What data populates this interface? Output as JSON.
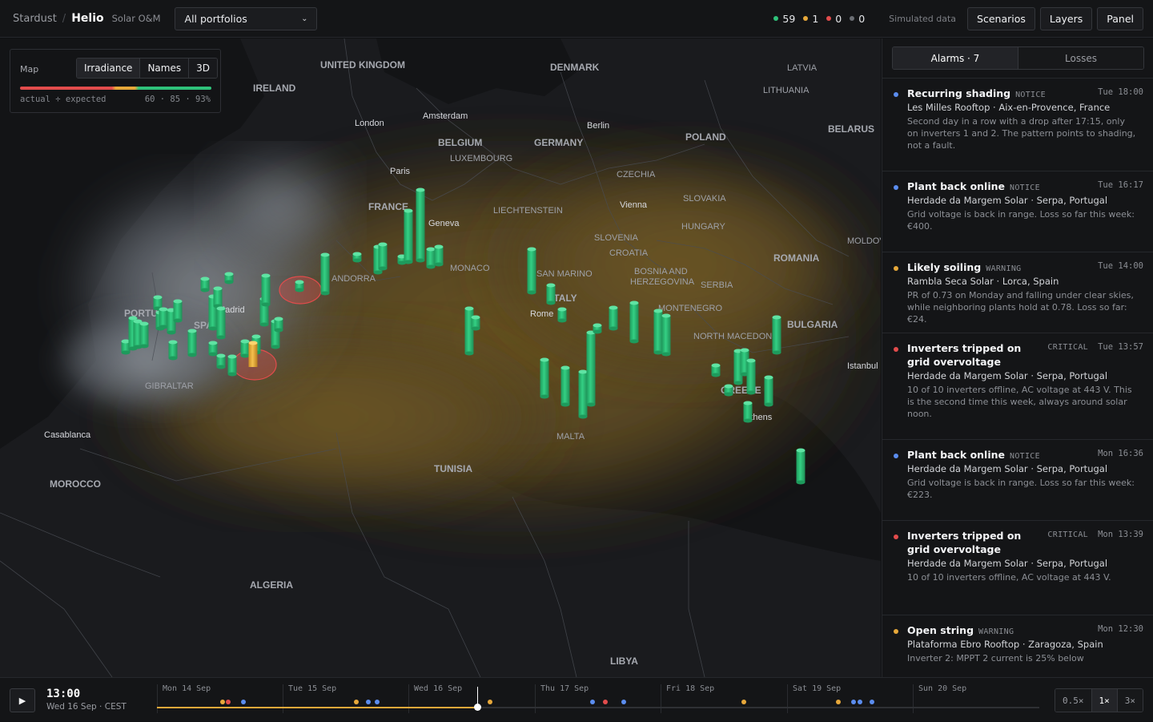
{
  "header": {
    "org": "Stardust",
    "app": "Helio",
    "subtitle": "Solar O&M",
    "portfolio": "All portfolios",
    "counts": [
      {
        "value": "59",
        "color": "#2fc27a"
      },
      {
        "value": "1",
        "color": "#e7a83a"
      },
      {
        "value": "0",
        "color": "#e24c4c"
      },
      {
        "value": "0",
        "color": "#6b6e74"
      }
    ],
    "simulated": "Simulated data",
    "buttons": {
      "scenarios": "Scenarios",
      "layers": "Layers",
      "panel": "Panel"
    }
  },
  "legend": {
    "title": "Map",
    "tabs": [
      "Irradiance",
      "Names",
      "3D"
    ],
    "caption": "actual ÷ expected",
    "scale": "60 · 85 · 93%"
  },
  "map": {
    "labels": [
      {
        "text": "UNITED KINGDOM",
        "kind": "country"
      },
      {
        "text": "IRELAND",
        "kind": "country"
      },
      {
        "text": "DENMARK",
        "kind": "country"
      },
      {
        "text": "LATVIA",
        "kind": "country"
      },
      {
        "text": "LITHUANIA",
        "kind": "country"
      },
      {
        "text": "BELARUS",
        "kind": "country"
      },
      {
        "text": "London",
        "kind": "city"
      },
      {
        "text": "Amsterdam",
        "kind": "city"
      },
      {
        "text": "Berlin",
        "kind": "city"
      },
      {
        "text": "BELGIUM",
        "kind": "country"
      },
      {
        "text": "GERMANY",
        "kind": "country"
      },
      {
        "text": "POLAND",
        "kind": "country"
      },
      {
        "text": "LUXEMBOURG",
        "kind": "minor"
      },
      {
        "text": "Paris",
        "kind": "city"
      },
      {
        "text": "CZECHIA",
        "kind": "minor"
      },
      {
        "text": "FRANCE",
        "kind": "country"
      },
      {
        "text": "Geneva",
        "kind": "city"
      },
      {
        "text": "LIECHTENSTEIN",
        "kind": "minor"
      },
      {
        "text": "Vienna",
        "kind": "city"
      },
      {
        "text": "SLOVAKIA",
        "kind": "minor"
      },
      {
        "text": "HUNGARY",
        "kind": "minor"
      },
      {
        "text": "MOLDOVA",
        "kind": "minor"
      },
      {
        "text": "ROMANIA",
        "kind": "country"
      },
      {
        "text": "SLOVENIA",
        "kind": "minor"
      },
      {
        "text": "CROATIA",
        "kind": "minor"
      },
      {
        "text": "MONACO",
        "kind": "minor"
      },
      {
        "text": "SAN MARINO",
        "kind": "minor"
      },
      {
        "text": "BOSNIA AND",
        "kind": "minor"
      },
      {
        "text": "HERZEGOVINA",
        "kind": "minor"
      },
      {
        "text": "SERBIA",
        "kind": "minor"
      },
      {
        "text": "ANDORRA",
        "kind": "minor"
      },
      {
        "text": "ITALY",
        "kind": "country"
      },
      {
        "text": "Rome",
        "kind": "city"
      },
      {
        "text": "MONTENEGRO",
        "kind": "minor"
      },
      {
        "text": "PORTUGAL",
        "kind": "country"
      },
      {
        "text": "Madrid",
        "kind": "city"
      },
      {
        "text": "SPAIN",
        "kind": "country"
      },
      {
        "text": "NORTH MACEDONIA",
        "kind": "minor"
      },
      {
        "text": "BULGARIA",
        "kind": "country"
      },
      {
        "text": "Istanbul",
        "kind": "city"
      },
      {
        "text": "GREECE",
        "kind": "country"
      },
      {
        "text": "Athens",
        "kind": "city"
      },
      {
        "text": "GIBRALTAR",
        "kind": "minor"
      },
      {
        "text": "Casablanca",
        "kind": "city"
      },
      {
        "text": "MALTA",
        "kind": "minor"
      },
      {
        "text": "TUNISIA",
        "kind": "country"
      },
      {
        "text": "MOROCCO",
        "kind": "country"
      },
      {
        "text": "ALGERIA",
        "kind": "country"
      },
      {
        "text": "LIBYA",
        "kind": "country"
      }
    ]
  },
  "panel": {
    "tabs": [
      "Alarms · 7",
      "Losses"
    ],
    "alarms": [
      {
        "title": "Recurring shading",
        "severity": "NOTICE",
        "color": "#5b8def",
        "time": "Tue 18:00",
        "site": "Les Milles Rooftop · Aix-en-Provence, France",
        "desc": "Second day in a row with a drop after 17:15, only on inverters 1 and 2. The pattern points to shading, not a fault."
      },
      {
        "title": "Plant back online",
        "severity": "NOTICE",
        "color": "#5b8def",
        "time": "Tue 16:17",
        "site": "Herdade da Margem Solar · Serpa, Portugal",
        "desc": "Grid voltage is back in range. Loss so far this week: €400."
      },
      {
        "title": "Likely soiling",
        "severity": "WARNING",
        "color": "#e7a83a",
        "time": "Tue 14:00",
        "site": "Rambla Seca Solar · Lorca, Spain",
        "desc": "PR of 0.73 on Monday and falling under clear skies, while neighboring plants hold at 0.78. Loss so far: €24."
      },
      {
        "title": "Inverters tripped on grid overvoltage",
        "severity": "CRITICAL",
        "color": "#e24c4c",
        "time": "Tue 13:57",
        "site": "Herdade da Margem Solar · Serpa, Portugal",
        "desc": "10 of 10 inverters offline, AC voltage at 443 V. This is the second time this week, always around solar noon."
      },
      {
        "title": "Plant back online",
        "severity": "NOTICE",
        "color": "#5b8def",
        "time": "Mon 16:36",
        "site": "Herdade da Margem Solar · Serpa, Portugal",
        "desc": "Grid voltage is back in range. Loss so far this week: €223."
      },
      {
        "title": "Inverters tripped on grid overvoltage",
        "severity": "CRITICAL",
        "color": "#e24c4c",
        "time": "Mon 13:39",
        "site": "Herdade da Margem Solar · Serpa, Portugal",
        "desc": "10 of 10 inverters offline, AC voltage at 443 V."
      },
      {
        "title": "Open string",
        "severity": "WARNING",
        "color": "#e7a83a",
        "time": "Mon 12:30",
        "site": "Plataforma Ebro Rooftop · Zaragoza, Spain",
        "desc": "Inverter 2: MPPT 2 current is 25% below"
      }
    ]
  },
  "footer": {
    "play_icon": "play-icon",
    "time": "13:00",
    "date": "Wed 16 Sep · CEST",
    "days": [
      "Mon 14 Sep",
      "Tue 15 Sep",
      "Wed 16 Sep",
      "Thu 17 Sep",
      "Fri 18 Sep",
      "Sat 19 Sep",
      "Sun 20 Sep"
    ],
    "speeds": [
      "0.5×",
      "1×",
      "3×"
    ],
    "active_speed": "1×"
  }
}
